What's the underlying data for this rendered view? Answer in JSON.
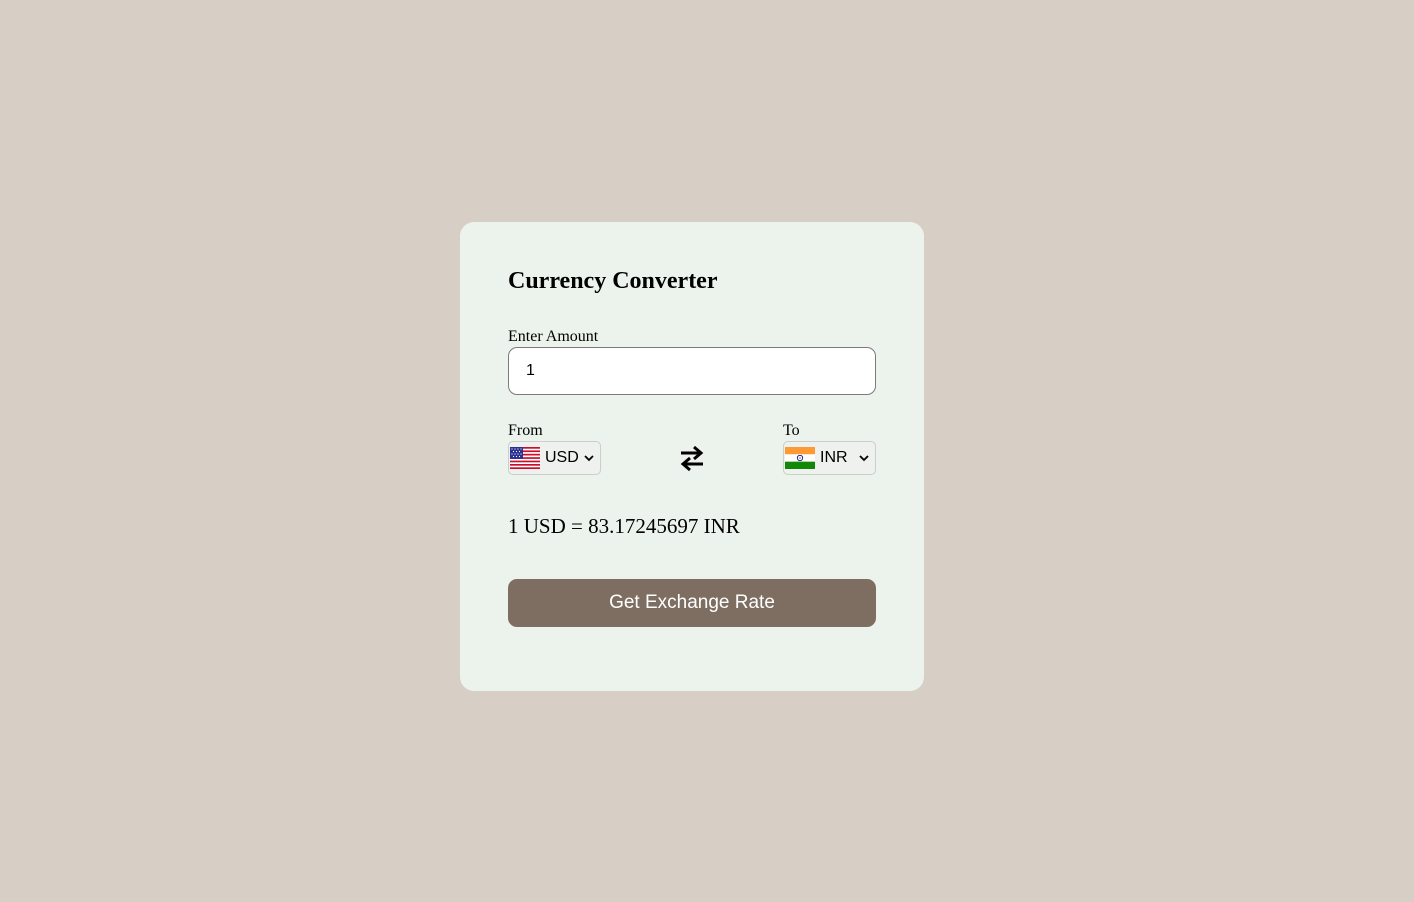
{
  "converter": {
    "title": "Currency Converter",
    "amount_label": "Enter Amount",
    "amount_value": "1",
    "from_label": "From",
    "to_label": "To",
    "from_currency": {
      "code": "USD",
      "flag_icon": "us-flag-icon"
    },
    "to_currency": {
      "code": "INR",
      "flag_icon": "india-flag-icon"
    },
    "swap_icon": "swap-arrows-icon",
    "result_text": "1 USD = 83.17245697 INR",
    "button_label": "Get Exchange Rate"
  },
  "colors": {
    "page_background": "#d7cfc6",
    "card_background": "#ebf3ec",
    "button_background": "#7e6e62",
    "button_text": "#ffffff"
  }
}
